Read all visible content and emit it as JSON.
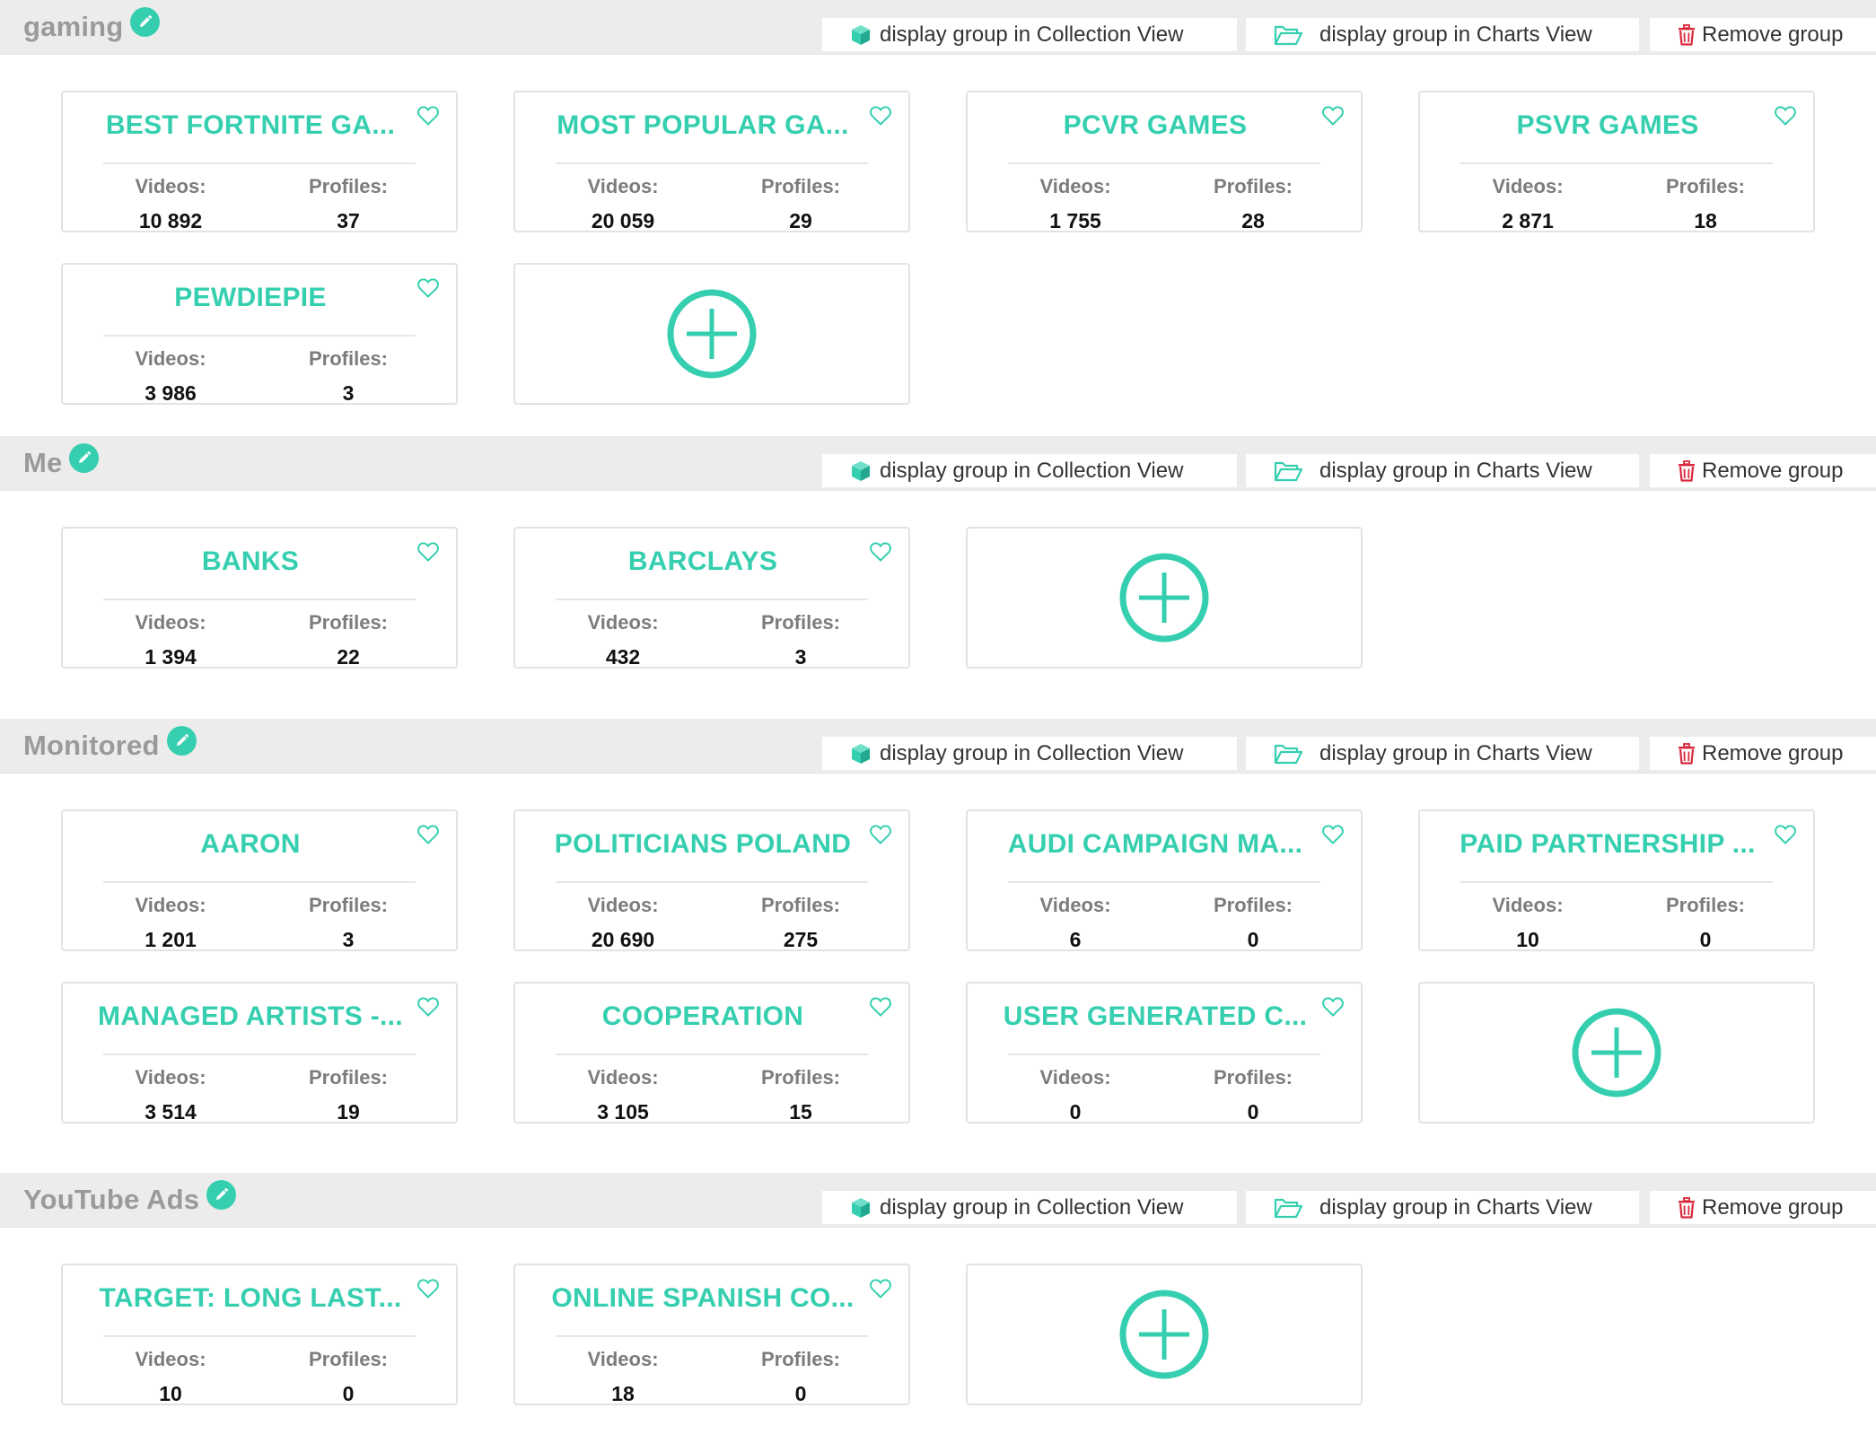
{
  "labels": {
    "collection_btn": "display group in Collection View",
    "charts_btn": "display group in Charts View",
    "remove_btn": "Remove group",
    "videos": "Videos:",
    "profiles": "Profiles:"
  },
  "colors": {
    "accent": "#35cfb0",
    "remove_icon": "#d9283c",
    "header_bg": "#ececec"
  },
  "icons": [
    "pencil-icon",
    "cube-icon",
    "folder-open-icon",
    "trash-icon",
    "heart-outline-icon",
    "plus-circle-icon"
  ],
  "groups": [
    {
      "title": "gaming",
      "cards": [
        {
          "title": "BEST FORTNITE GA...",
          "videos": "10 892",
          "profiles": "37"
        },
        {
          "title": "MOST POPULAR GA...",
          "videos": "20 059",
          "profiles": "29"
        },
        {
          "title": "PCVR GAMES",
          "videos": "1 755",
          "profiles": "28"
        },
        {
          "title": "PSVR GAMES",
          "videos": "2 871",
          "profiles": "18"
        },
        {
          "title": "PEWDIEPIE",
          "videos": "3 986",
          "profiles": "3"
        }
      ]
    },
    {
      "title": "Me",
      "cards": [
        {
          "title": "BANKS",
          "videos": "1 394",
          "profiles": "22"
        },
        {
          "title": "BARCLAYS",
          "videos": "432",
          "profiles": "3"
        }
      ]
    },
    {
      "title": "Monitored",
      "cards": [
        {
          "title": "AARON",
          "videos": "1 201",
          "profiles": "3"
        },
        {
          "title": "POLITICIANS POLAND",
          "videos": "20 690",
          "profiles": "275"
        },
        {
          "title": "AUDI CAMPAIGN MA...",
          "videos": "6",
          "profiles": "0"
        },
        {
          "title": "PAID PARTNERSHIP ...",
          "videos": "10",
          "profiles": "0"
        },
        {
          "title": "MANAGED ARTISTS -...",
          "videos": "3 514",
          "profiles": "19"
        },
        {
          "title": "COOPERATION",
          "videos": "3 105",
          "profiles": "15"
        },
        {
          "title": "USER GENERATED C...",
          "videos": "0",
          "profiles": "0"
        }
      ]
    },
    {
      "title": "YouTube Ads",
      "cards": [
        {
          "title": "TARGET: LONG LAST...",
          "videos": "10",
          "profiles": "0"
        },
        {
          "title": "ONLINE SPANISH CO...",
          "videos": "18",
          "profiles": "0"
        }
      ]
    }
  ]
}
